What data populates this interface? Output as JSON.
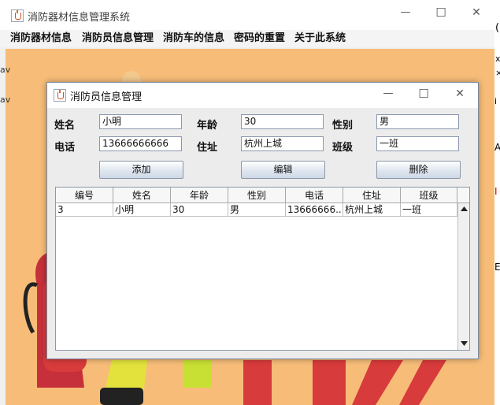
{
  "main_window": {
    "title": "消防器材信息管理系统",
    "controls": {
      "minimize": "—",
      "maximize": "☐",
      "close": "✕"
    }
  },
  "menu": [
    "消防器材信息",
    "消防员信息管理",
    "消防车的信息",
    "密码的重置",
    "关于此系统"
  ],
  "edge_fragments": [
    "(",
    "x",
    "×",
    "▬",
    "i",
    "A",
    "I",
    "E"
  ],
  "left_fragments": [
    "av",
    "av"
  ],
  "dialog": {
    "title": "消防员信息管理",
    "controls": {
      "minimize": "—",
      "maximize": "☐",
      "close": "✕"
    },
    "form": {
      "name": {
        "label": "姓名",
        "value": "小明"
      },
      "age": {
        "label": "年龄",
        "value": "30"
      },
      "gender": {
        "label": "性别",
        "value": "男"
      },
      "phone": {
        "label": "电话",
        "value": "13666666666"
      },
      "address": {
        "label": "住址",
        "value": "杭州上城"
      },
      "class": {
        "label": "班级",
        "value": "一班"
      }
    },
    "buttons": {
      "add": "添加",
      "edit": "编辑",
      "delete": "删除"
    },
    "table": {
      "columns": [
        "编号",
        "姓名",
        "年龄",
        "性别",
        "电话",
        "住址",
        "班级"
      ],
      "rows": [
        [
          "3",
          "小明",
          "30",
          "男",
          "13666666...",
          "杭州上城",
          "一班"
        ]
      ]
    }
  },
  "colors": {
    "background_image": "#f7bd78",
    "extinguisher_red": "#d43a3a",
    "accent_yellow": "#e8e53a"
  }
}
